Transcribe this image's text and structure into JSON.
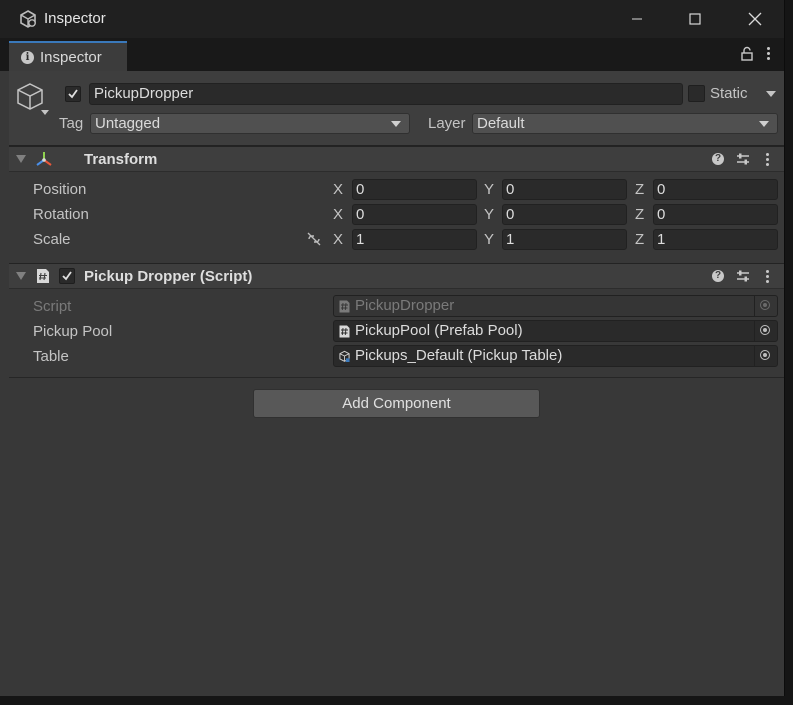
{
  "window": {
    "title": "Inspector",
    "icons": {
      "app": "unity-icon",
      "minimize": "minimize-icon",
      "maximize": "maximize-icon",
      "close": "close-icon"
    }
  },
  "tab": {
    "label": "Inspector",
    "icon": "info-icon"
  },
  "gameobject": {
    "active": true,
    "name": "PickupDropper",
    "static_label": "Static",
    "static": false,
    "tag_label": "Tag",
    "tag_value": "Untagged",
    "layer_label": "Layer",
    "layer_value": "Default"
  },
  "transform": {
    "title": "Transform",
    "rows": [
      {
        "label": "Position",
        "x": "0",
        "y": "0",
        "z": "0"
      },
      {
        "label": "Rotation",
        "x": "0",
        "y": "0",
        "z": "0"
      },
      {
        "label": "Scale",
        "x": "1",
        "y": "1",
        "z": "1"
      }
    ],
    "axes": {
      "x": "X",
      "y": "Y",
      "z": "Z"
    }
  },
  "script_component": {
    "title": "Pickup Dropper (Script)",
    "enabled": true,
    "fields": [
      {
        "label": "Script",
        "value": "PickupDropper",
        "icon": "script-icon"
      },
      {
        "label": "Pickup Pool",
        "value": "PickupPool (Prefab Pool)",
        "icon": "script-icon"
      },
      {
        "label": "Table",
        "value": "Pickups_Default (Pickup Table)",
        "icon": "scriptable-object-icon"
      }
    ]
  },
  "add_component_label": "Add Component",
  "help_glyph": "?",
  "info_glyph": "i",
  "colors": {
    "tab_accent": "#3a79bb",
    "panel": "#383838",
    "header": "#3e3e3e",
    "field": "#2a2a2a"
  }
}
